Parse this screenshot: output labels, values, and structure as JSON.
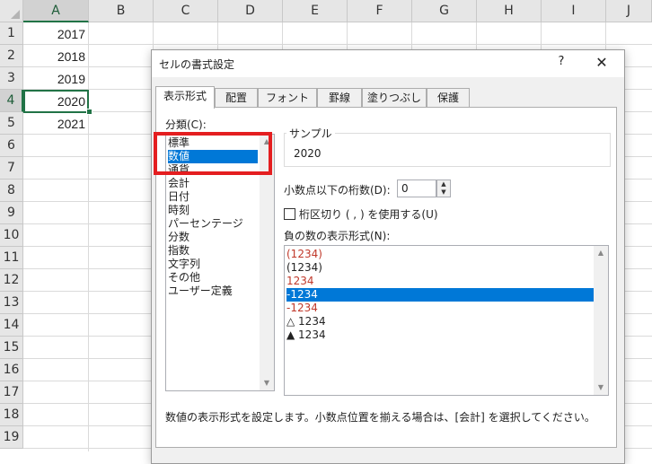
{
  "columns": [
    "A",
    "B",
    "C",
    "D",
    "E",
    "F",
    "G",
    "H",
    "I",
    "J"
  ],
  "rows": [
    "1",
    "2",
    "3",
    "4",
    "5",
    "6",
    "7",
    "8",
    "9",
    "10",
    "11",
    "12",
    "13",
    "14",
    "15",
    "16",
    "17",
    "18",
    "19"
  ],
  "cells": [
    "2017",
    "2018",
    "2019",
    "2020",
    "2021"
  ],
  "dialog": {
    "title": "セルの書式設定",
    "help": "?",
    "close": "✕",
    "tabs": [
      "表示形式",
      "配置",
      "フォント",
      "罫線",
      "塗りつぶし",
      "保護"
    ],
    "category_label": "分類(C):",
    "categories": [
      "標準",
      "数値",
      "通貨",
      "会計",
      "日付",
      "時刻",
      "パーセンテージ",
      "分数",
      "指数",
      "文字列",
      "その他",
      "ユーザー定義"
    ],
    "selected_category": "数値",
    "sample_label": "サンプル",
    "sample_value": "2020",
    "decimal_label": "小数点以下の桁数(D):",
    "decimal_value": "0",
    "separator_label": "桁区切り ( , ) を使用する(U)",
    "negative_label": "負の数の表示形式(N):",
    "negative_formats": [
      {
        "text": "(1234)",
        "color": "#c0392b"
      },
      {
        "text": "(1234)",
        "color": "#222222"
      },
      {
        "text": "1234",
        "color": "#c0392b"
      },
      {
        "text": "-1234",
        "color": "#ffffff"
      },
      {
        "text": "-1234",
        "color": "#c0392b"
      },
      {
        "text": "△ 1234",
        "color": "#222222"
      },
      {
        "text": "▲ 1234",
        "color": "#222222"
      }
    ],
    "selected_negative_index": 3,
    "description": "数値の表示形式を設定します。小数点位置を揃える場合は、[会計] を選択してください。"
  },
  "colors": {
    "excel_green": "#217346",
    "selection_blue": "#0078d7",
    "highlight_red": "#e41e20"
  }
}
